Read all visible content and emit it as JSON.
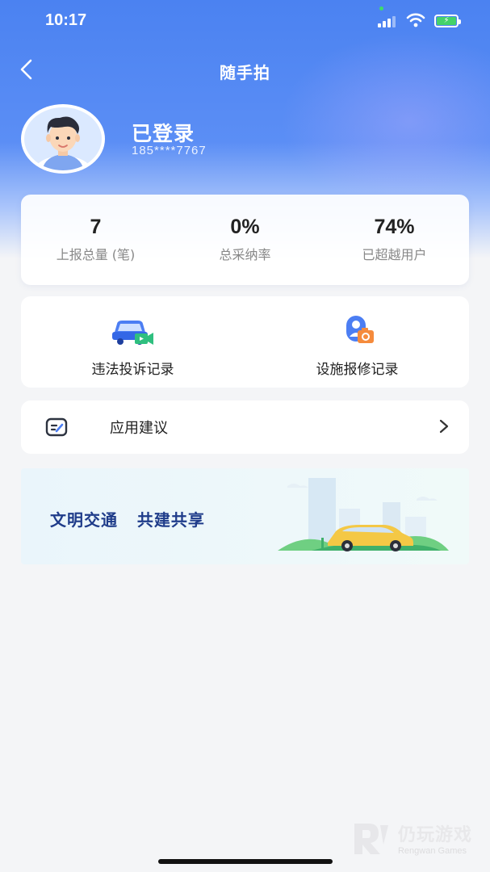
{
  "status_bar": {
    "time": "10:17"
  },
  "nav": {
    "title": "随手拍"
  },
  "user": {
    "name": "已登录",
    "phone": "185****7767"
  },
  "stats": [
    {
      "value": "7",
      "label": "上报总量 (笔)"
    },
    {
      "value": "0%",
      "label": "总采纳率"
    },
    {
      "value": "74%",
      "label": "已超越用户"
    }
  ],
  "records": [
    {
      "label": "违法投诉记录",
      "icon": "car-video-icon"
    },
    {
      "label": "设施报修记录",
      "icon": "person-camera-icon"
    }
  ],
  "suggestion": {
    "label": "应用建议",
    "icon": "edit-note-icon"
  },
  "banner": {
    "text": "文明交通   共建共享"
  },
  "watermark": {
    "name": "仍玩游戏",
    "sub": "Rengwan Games"
  },
  "colors": {
    "primary": "#4b82f1",
    "banner_text": "#1f3c8a",
    "green": "#45d26a"
  }
}
